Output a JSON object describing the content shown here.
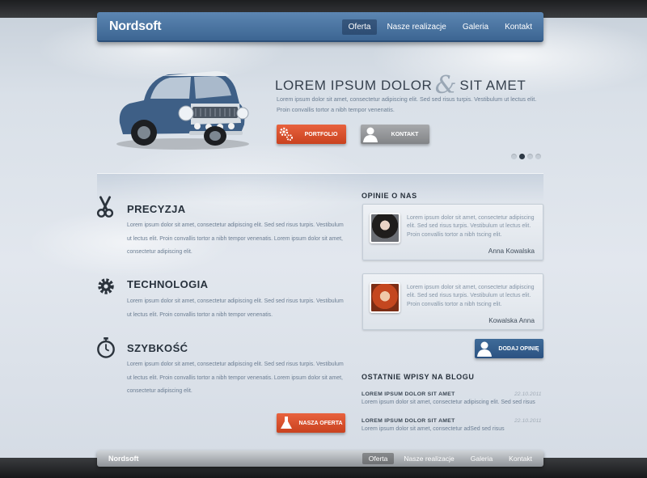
{
  "brand": "Nordsoft",
  "nav": [
    "Oferta",
    "Nasze realizacje",
    "Galeria",
    "Kontakt"
  ],
  "nav_active": 0,
  "hero": {
    "title_left": "LOREM IPSUM DOLOR",
    "ampersand": "&",
    "title_right": "SIT AMET",
    "text": "Lorem ipsum dolor sit amet, consectetur adipiscing elit. Sed sed risus turpis. Vestibulum ut lectus elit. Proin convallis tortor a nibh tempor venenatis.",
    "btn_portfolio": "PORTFOLIO",
    "btn_kontakt": "KONTAKT",
    "slides_count": 4,
    "slide_active": 1
  },
  "features": [
    {
      "title": "PRECYZJA",
      "icon": "scissors-icon",
      "text": "Lorem ipsum dolor sit amet, consectetur adipiscing elit. Sed sed risus turpis. Vestibulum ut lectus elit. Proin convallis tortor a nibh tempor venenatis. Lorem ipsum dolor sit amet, consectetur adipiscing elit."
    },
    {
      "title": "TECHNOLOGIA",
      "icon": "gear-icon",
      "text": "Lorem ipsum dolor sit amet, consectetur adipiscing elit. Sed sed risus turpis. Vestibulum ut lectus elit. Proin convallis tortor a nibh tempor venenatis."
    },
    {
      "title": "SZYBKOŚĆ",
      "icon": "stopwatch-icon",
      "text": "Lorem ipsum dolor sit amet, consectetur adipiscing elit. Sed sed risus turpis. Vestibulum ut lectus elit. Proin convallis tortor a nibh tempor venenatis. Lorem ipsum dolor sit amet, consectetur adipiscing elit."
    }
  ],
  "btn_nasza_oferta": "NASZA OFERTA",
  "opinions": {
    "title": "OPINIE O NAS",
    "items": [
      {
        "text": "Lorem ipsum dolor sit amet, consectetur adipiscing elit. Sed sed risus turpis. Vestibulum ut lectus elit. Proin convallis tortor a nibh tscing elit.",
        "author": "Anna Kowalska"
      },
      {
        "text": "Lorem ipsum dolor sit amet, consectetur adipiscing elit. Sed sed risus turpis. Vestibulum ut lectus elit. Proin convallis tortor a nibh tscing elit.",
        "author": "Kowalska Anna"
      }
    ],
    "add_button": "DODAJ OPINIĘ"
  },
  "blog": {
    "title": "OSTATNIE WPISY NA BLOGU",
    "posts": [
      {
        "title": "LOREM IPSUM DOLOR SIT AMET",
        "date": "22.10.2011",
        "text": "Lorem ipsum dolor sit amet, consectetur adipiscing elit. Sed sed risus"
      },
      {
        "title": "LOREM IPSUM DOLOR SIT AMET",
        "date": "22.10.2011",
        "text": "Lorem ipsum dolor sit amet, consectetur adSed sed risus"
      }
    ]
  },
  "colors": {
    "nav_blue": "#4a74a1",
    "accent_orange": "#d9512c",
    "button_grey": "#939598",
    "button_blue": "#355e8c",
    "heading": "#27313c",
    "body_text": "#6b7d92"
  }
}
